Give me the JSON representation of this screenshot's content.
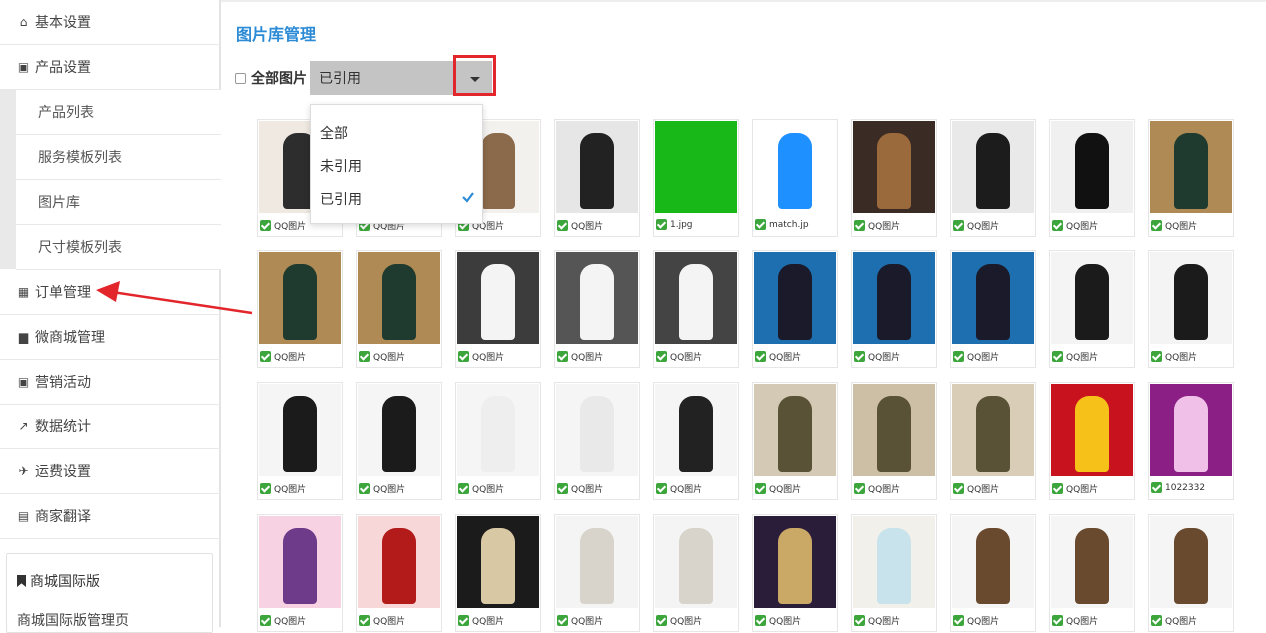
{
  "sidebar": {
    "items": [
      {
        "label": "基本设置",
        "icon": "home-icon",
        "glyph": "⌂"
      },
      {
        "label": "产品设置",
        "icon": "gift-icon",
        "glyph": "▣"
      },
      {
        "label": "订单管理",
        "icon": "calendar-icon",
        "glyph": "▦"
      },
      {
        "label": "微商城管理",
        "icon": "shopping-bag-icon",
        "glyph": "▆"
      },
      {
        "label": "营销活动",
        "icon": "gift-icon",
        "glyph": "▣"
      },
      {
        "label": "数据统计",
        "icon": "line-chart-icon",
        "glyph": "↗"
      },
      {
        "label": "运费设置",
        "icon": "plane-icon",
        "glyph": "✈"
      },
      {
        "label": "商家翻译",
        "icon": "book-icon",
        "glyph": "▤"
      }
    ],
    "sub_items": [
      "产品列表",
      "服务模板列表",
      "图片库",
      "尺寸模板列表"
    ],
    "intl": {
      "title": "商城国际版",
      "link": "商城国际版管理页",
      "icon": "bookmark-icon"
    }
  },
  "main": {
    "title": "图片库管理",
    "all_label": "全部图片",
    "select_value": "已引用",
    "dropdown_options": [
      "全部",
      "未引用",
      "已引用"
    ]
  },
  "colors": {
    "accent": "#2b8bd6",
    "highlight_red": "#e2262b",
    "check_green": "#3ca63c"
  },
  "images": [
    {
      "caption": "QQ图片"
    },
    {
      "caption": "QQ图片"
    },
    {
      "caption": "QQ图片"
    },
    {
      "caption": "QQ图片"
    },
    {
      "caption": "1.jpg"
    },
    {
      "caption": "match.jp"
    },
    {
      "caption": "QQ图片"
    },
    {
      "caption": "QQ图片"
    },
    {
      "caption": "QQ图片"
    },
    {
      "caption": "QQ图片"
    },
    {
      "caption": "QQ图片"
    },
    {
      "caption": "QQ图片"
    },
    {
      "caption": "QQ图片"
    },
    {
      "caption": "QQ图片"
    },
    {
      "caption": "QQ图片"
    },
    {
      "caption": "QQ图片"
    },
    {
      "caption": "QQ图片"
    },
    {
      "caption": "QQ图片"
    },
    {
      "caption": "QQ图片"
    },
    {
      "caption": "QQ图片"
    },
    {
      "caption": "QQ图片"
    },
    {
      "caption": "QQ图片"
    },
    {
      "caption": "QQ图片"
    },
    {
      "caption": "QQ图片"
    },
    {
      "caption": "QQ图片"
    },
    {
      "caption": "QQ图片"
    },
    {
      "caption": "QQ图片"
    },
    {
      "caption": "QQ图片"
    },
    {
      "caption": "QQ图片"
    },
    {
      "caption": "1022332"
    },
    {
      "caption": "QQ图片"
    },
    {
      "caption": "QQ图片"
    },
    {
      "caption": "QQ图片"
    },
    {
      "caption": "QQ图片"
    },
    {
      "caption": "QQ图片"
    },
    {
      "caption": "QQ图片"
    },
    {
      "caption": "QQ图片"
    },
    {
      "caption": "QQ图片"
    },
    {
      "caption": "QQ图片"
    },
    {
      "caption": "QQ图片"
    }
  ]
}
